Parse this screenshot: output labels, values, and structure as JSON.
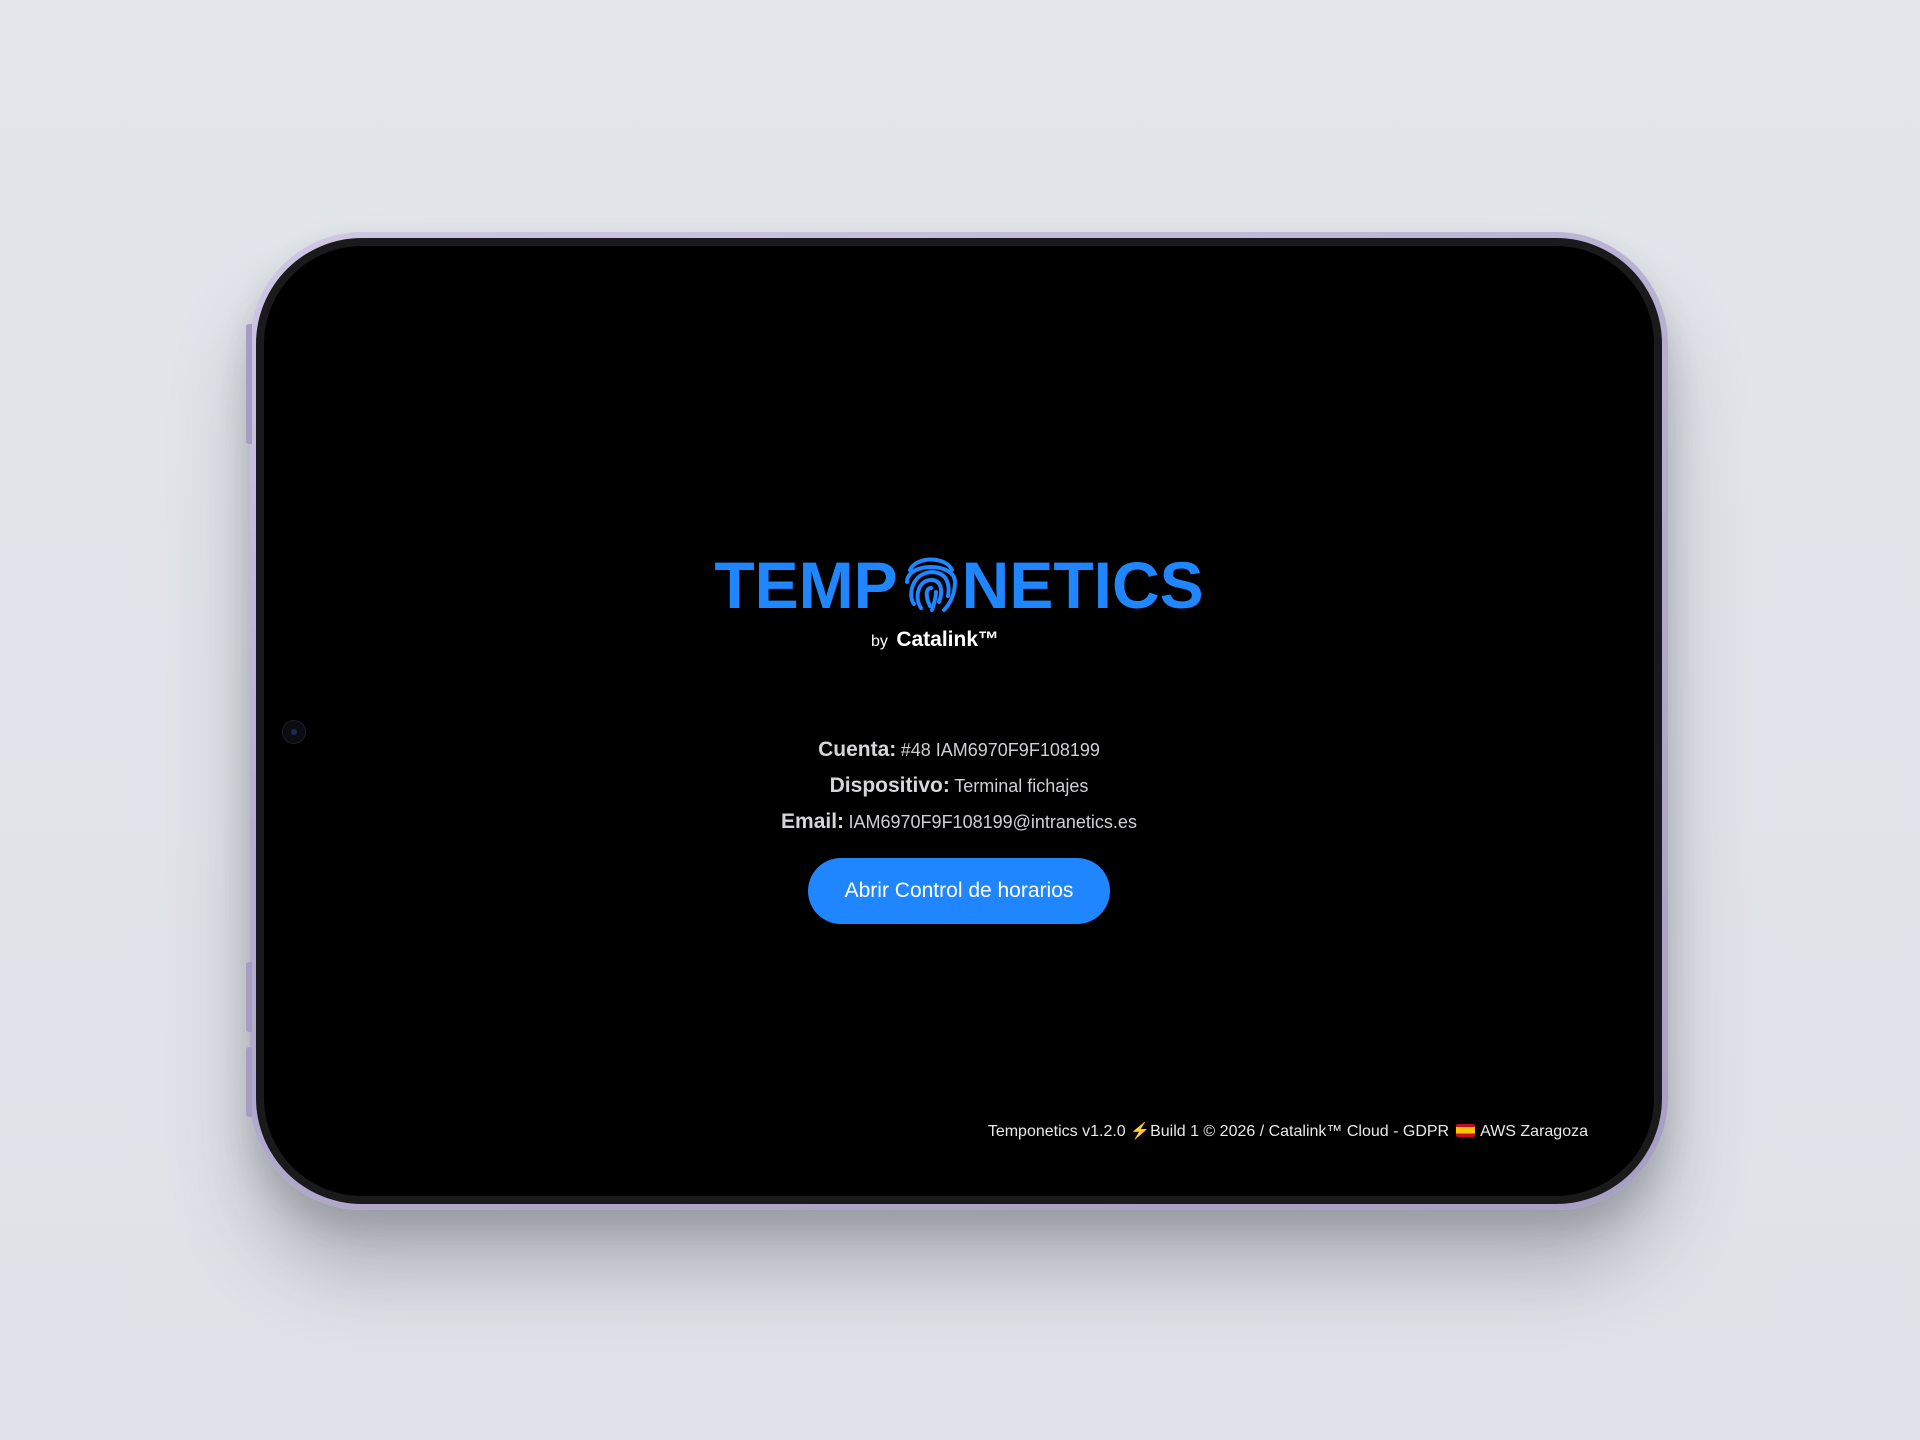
{
  "brand": {
    "wordmark_left": "TEMP",
    "wordmark_right": "NETICS",
    "fingerprint_icon": "fingerprint-icon",
    "by": "by",
    "company": "Catalink™",
    "accent_color": "#1f86ff"
  },
  "info": {
    "account_label": "Cuenta:",
    "account_value": "#48 IAM6970F9F108199",
    "device_label": "Dispositivo:",
    "device_value": "Terminal fichajes",
    "email_label": "Email:",
    "email_value": "IAM6970F9F108199@intranetics.es"
  },
  "actions": {
    "open_label": "Abrir Control de horarios"
  },
  "footer": {
    "version": "Temponetics v1.2.0",
    "bolt_icon": "lightning-icon",
    "build": "Build 1 © 2026 / Catalink™ Cloud - GDPR",
    "flag_icon": "spain-flag-icon",
    "region": "AWS Zaragoza"
  }
}
